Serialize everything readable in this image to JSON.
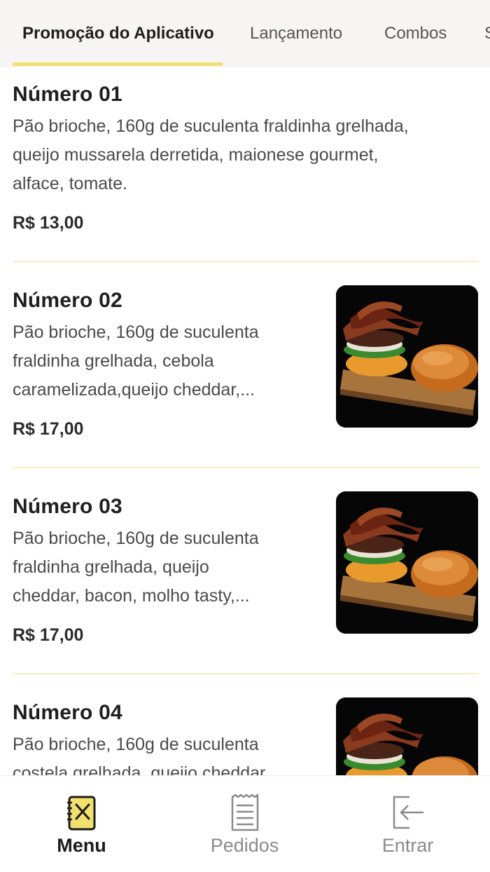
{
  "tabs": [
    {
      "label": "Promoção do Aplicativo",
      "active": true
    },
    {
      "label": "Lançamento",
      "active": false
    },
    {
      "label": "Combos",
      "active": false
    },
    {
      "label": "S",
      "active": false
    }
  ],
  "items": [
    {
      "title": "Número 01",
      "description_lines": [
        "Pão brioche, 160g de suculenta fraldinha grelhada,",
        "queijo mussarela derretida, maionese gourmet,",
        "alface, tomate."
      ],
      "price": "R$ 13,00",
      "has_image": false
    },
    {
      "title": "Número 02",
      "description_lines": [
        "Pão brioche, 160g de suculenta",
        "fraldinha grelhada, cebola",
        "caramelizada,queijo cheddar,..."
      ],
      "price": "R$ 17,00",
      "has_image": true
    },
    {
      "title": "Número 03",
      "description_lines": [
        "Pão brioche, 160g de suculenta",
        "fraldinha grelhada, queijo",
        "cheddar, bacon, molho tasty,..."
      ],
      "price": "R$ 17,00",
      "has_image": true
    },
    {
      "title": "Número 04",
      "description_lines": [
        "Pão brioche, 160g de suculenta",
        "costela grelhada, queijo cheddar"
      ],
      "price": "",
      "has_image": true
    }
  ],
  "bottom_nav": [
    {
      "label": "Menu",
      "icon": "menu-book-icon",
      "active": true
    },
    {
      "label": "Pedidos",
      "icon": "receipt-icon",
      "active": false
    },
    {
      "label": "Entrar",
      "icon": "login-icon",
      "active": false
    }
  ],
  "colors": {
    "accent": "#f3df6e",
    "divider": "#f8edc2",
    "tab_bar": "#f6f5f3"
  }
}
